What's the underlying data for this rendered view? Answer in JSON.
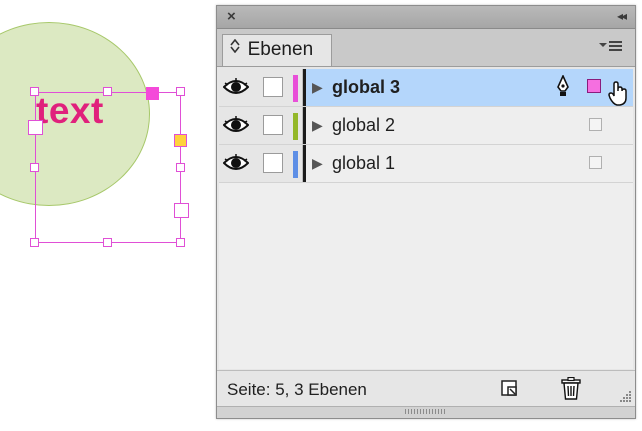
{
  "canvas": {
    "text": "text",
    "colors": {
      "circle_fill": "#dce9c2",
      "circle_stroke": "#a7c86a",
      "frame": "#e04fd6",
      "text": "#e0217c"
    }
  },
  "panel": {
    "tab": {
      "arrows": "◊",
      "label": "Ebenen"
    },
    "icons": {
      "close": "close-icon",
      "collapse": "collapse-icon",
      "menu": "panel-menu-icon"
    },
    "layers": [
      {
        "name": "global 3",
        "color": "#e84fd8",
        "selected": true
      },
      {
        "name": "global 2",
        "color": "#94b82a",
        "selected": false
      },
      {
        "name": "global 1",
        "color": "#5e8fe6",
        "selected": false
      }
    ],
    "status": "Seite: 5, 3 Ebenen"
  }
}
